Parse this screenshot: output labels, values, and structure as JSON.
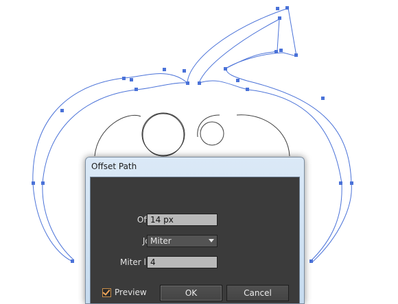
{
  "dialog": {
    "title": "Offset Path",
    "offset": {
      "label": "Offset:",
      "value": "14 px"
    },
    "joins": {
      "label": "Joins:",
      "selected": "Miter"
    },
    "miter_limit": {
      "label": "Miter limit:",
      "value": "4"
    },
    "preview": {
      "label": "Preview",
      "checked": true
    },
    "ok_label": "OK",
    "cancel_label": "Cancel"
  },
  "colors": {
    "path_selection": "#4a72d8",
    "outline": "#3c3c3c",
    "dialog_bg": "#3b3b3b",
    "checkbox_accent": "#f0a55a"
  }
}
